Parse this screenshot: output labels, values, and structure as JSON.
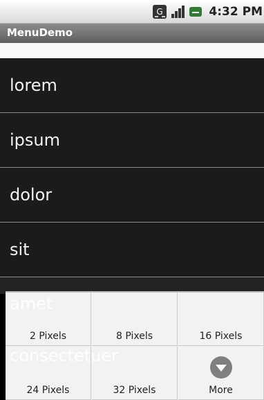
{
  "status_bar": {
    "time": "4:32 PM",
    "icons": [
      "data-sync-icon",
      "signal-icon",
      "battery-icon"
    ]
  },
  "app": {
    "title": "MenuDemo"
  },
  "list": {
    "items": [
      "lorem",
      "ipsum",
      "dolor",
      "sit"
    ]
  },
  "overlay": {
    "line1": "amet",
    "line2": "consectetuer"
  },
  "menu": {
    "items": [
      {
        "label": "2 Pixels"
      },
      {
        "label": "8 Pixels"
      },
      {
        "label": "16 Pixels"
      },
      {
        "label": "24 Pixels"
      },
      {
        "label": "32 Pixels"
      },
      {
        "label": "More",
        "icon": "chevron-down-circle-icon"
      }
    ]
  },
  "colors": {
    "list_bg": "#1b1b1b",
    "menu_bg": "#f2f2f2",
    "title_bar": "#6b6b6b"
  }
}
